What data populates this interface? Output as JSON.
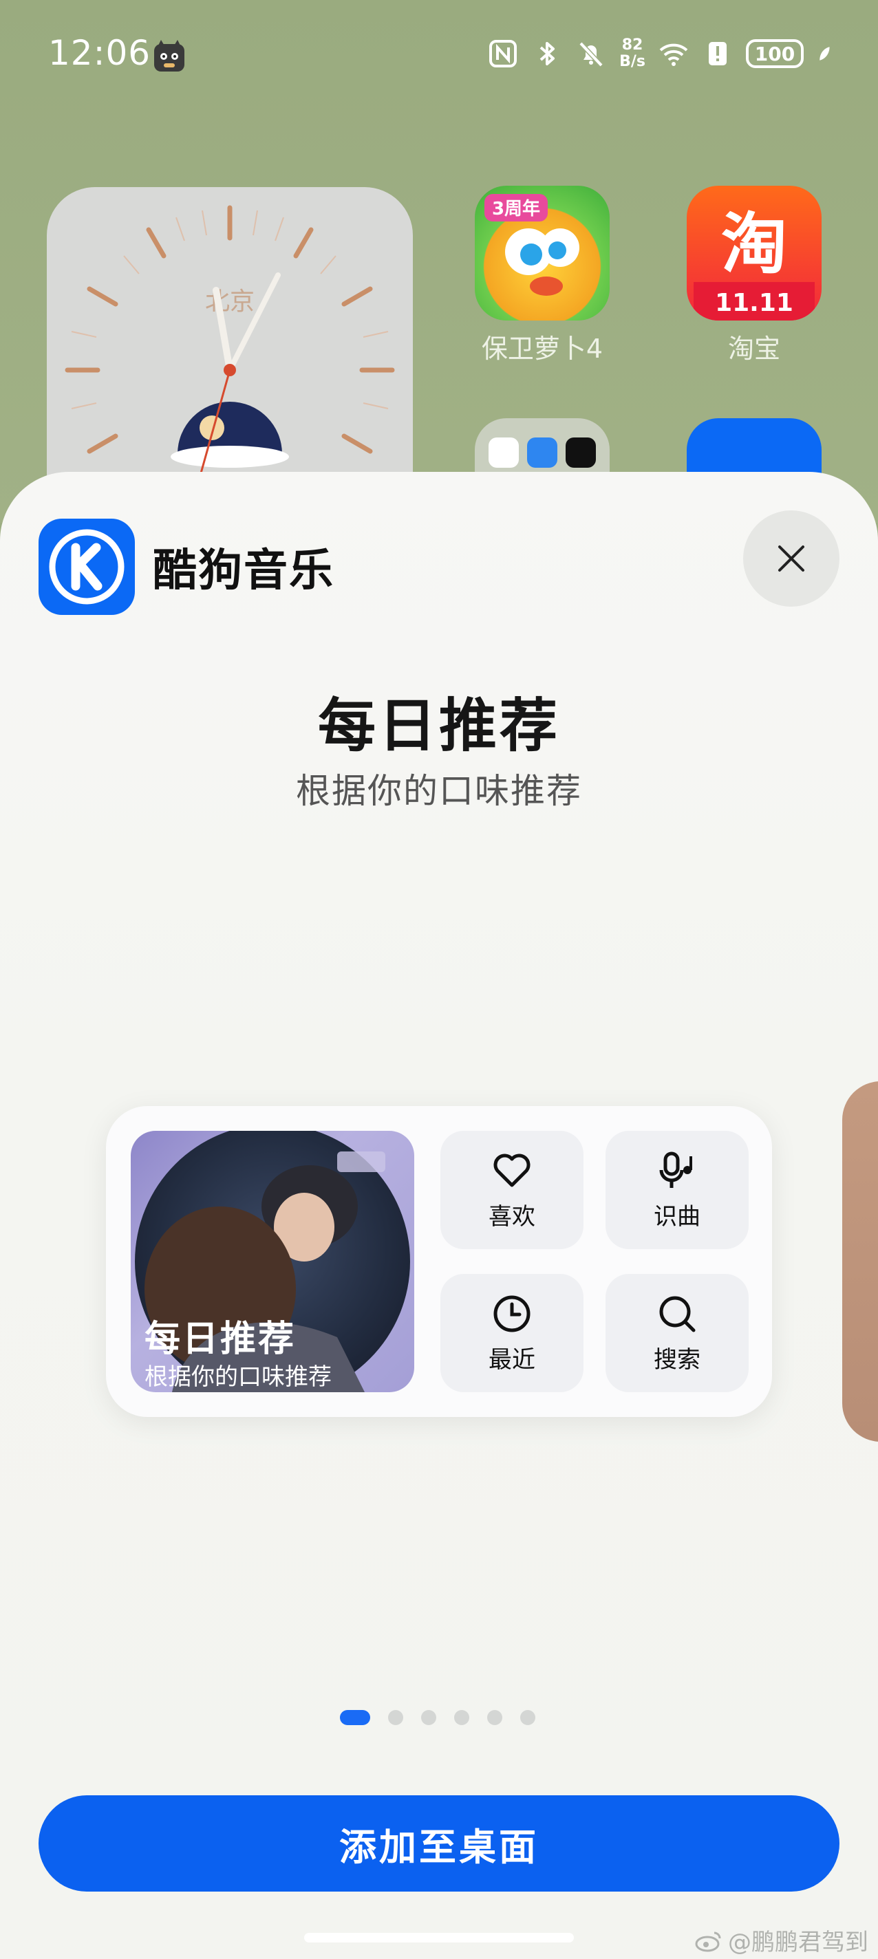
{
  "status_bar": {
    "time": "12:06",
    "net_speed_value": "82",
    "net_speed_unit": "B/s",
    "battery": "100"
  },
  "home": {
    "clock_city": "北京",
    "apps": [
      {
        "label": "保卫萝卜4",
        "badge": "3周年"
      },
      {
        "label": "淘宝",
        "badge": "11.11"
      }
    ]
  },
  "sheet": {
    "app_name": "酷狗音乐",
    "widget_title": "每日推荐",
    "widget_subtitle": "根据你的口味推荐",
    "widget": {
      "cover_title": "每日推荐",
      "cover_subtitle": "根据你的口味推荐",
      "actions": [
        {
          "label": "喜欢",
          "icon": "heart-icon"
        },
        {
          "label": "识曲",
          "icon": "mic-note-icon"
        },
        {
          "label": "最近",
          "icon": "clock-icon"
        },
        {
          "label": "搜索",
          "icon": "search-icon"
        }
      ]
    },
    "page_count": 6,
    "active_page": 1,
    "add_button": "添加至桌面"
  },
  "watermark": "@鹏鹏君驾到",
  "colors": {
    "accent": "#0b61f0",
    "wallpaper": "#9cad82",
    "sheet_bg": "#f5f6f3"
  }
}
